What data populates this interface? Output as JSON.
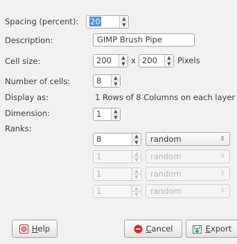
{
  "labels": {
    "spacing": "Spacing (percent):",
    "description": "Description:",
    "cell_size": "Cell size:",
    "num_cells": "Number of cells:",
    "display_as": "Display as:",
    "dimension": "Dimension:",
    "ranks": "Ranks:"
  },
  "fields": {
    "spacing_value": "20",
    "description_value": "GIMP Brush Pipe",
    "cell_width": "200",
    "cell_size_separator": "x",
    "cell_height": "200",
    "cell_unit": "Pixels",
    "num_cells_value": "8",
    "display_as_text": "1 Rows of  8 Columns on each layer",
    "dimension_value": "1"
  },
  "ranks": [
    {
      "value": "8",
      "mode": "random",
      "enabled": true
    },
    {
      "value": "1",
      "mode": "random",
      "enabled": false
    },
    {
      "value": "1",
      "mode": "random",
      "enabled": false
    },
    {
      "value": "1",
      "mode": "random",
      "enabled": false
    }
  ],
  "buttons": {
    "help_first": "H",
    "help_rest": "elp",
    "cancel_first": "C",
    "cancel_rest": "ancel",
    "export_first": "E",
    "export_rest": "xport"
  },
  "icons": {
    "help": "help-icon",
    "cancel": "cancel-icon",
    "export": "export-icon",
    "spin_up": "chevron-up-icon",
    "spin_down": "chevron-down-icon",
    "combo": "combo-arrows-icon"
  },
  "colors": {
    "background": "#f2f1f0",
    "selection": "#4a90d9",
    "cancel_red": "#e0242a"
  }
}
